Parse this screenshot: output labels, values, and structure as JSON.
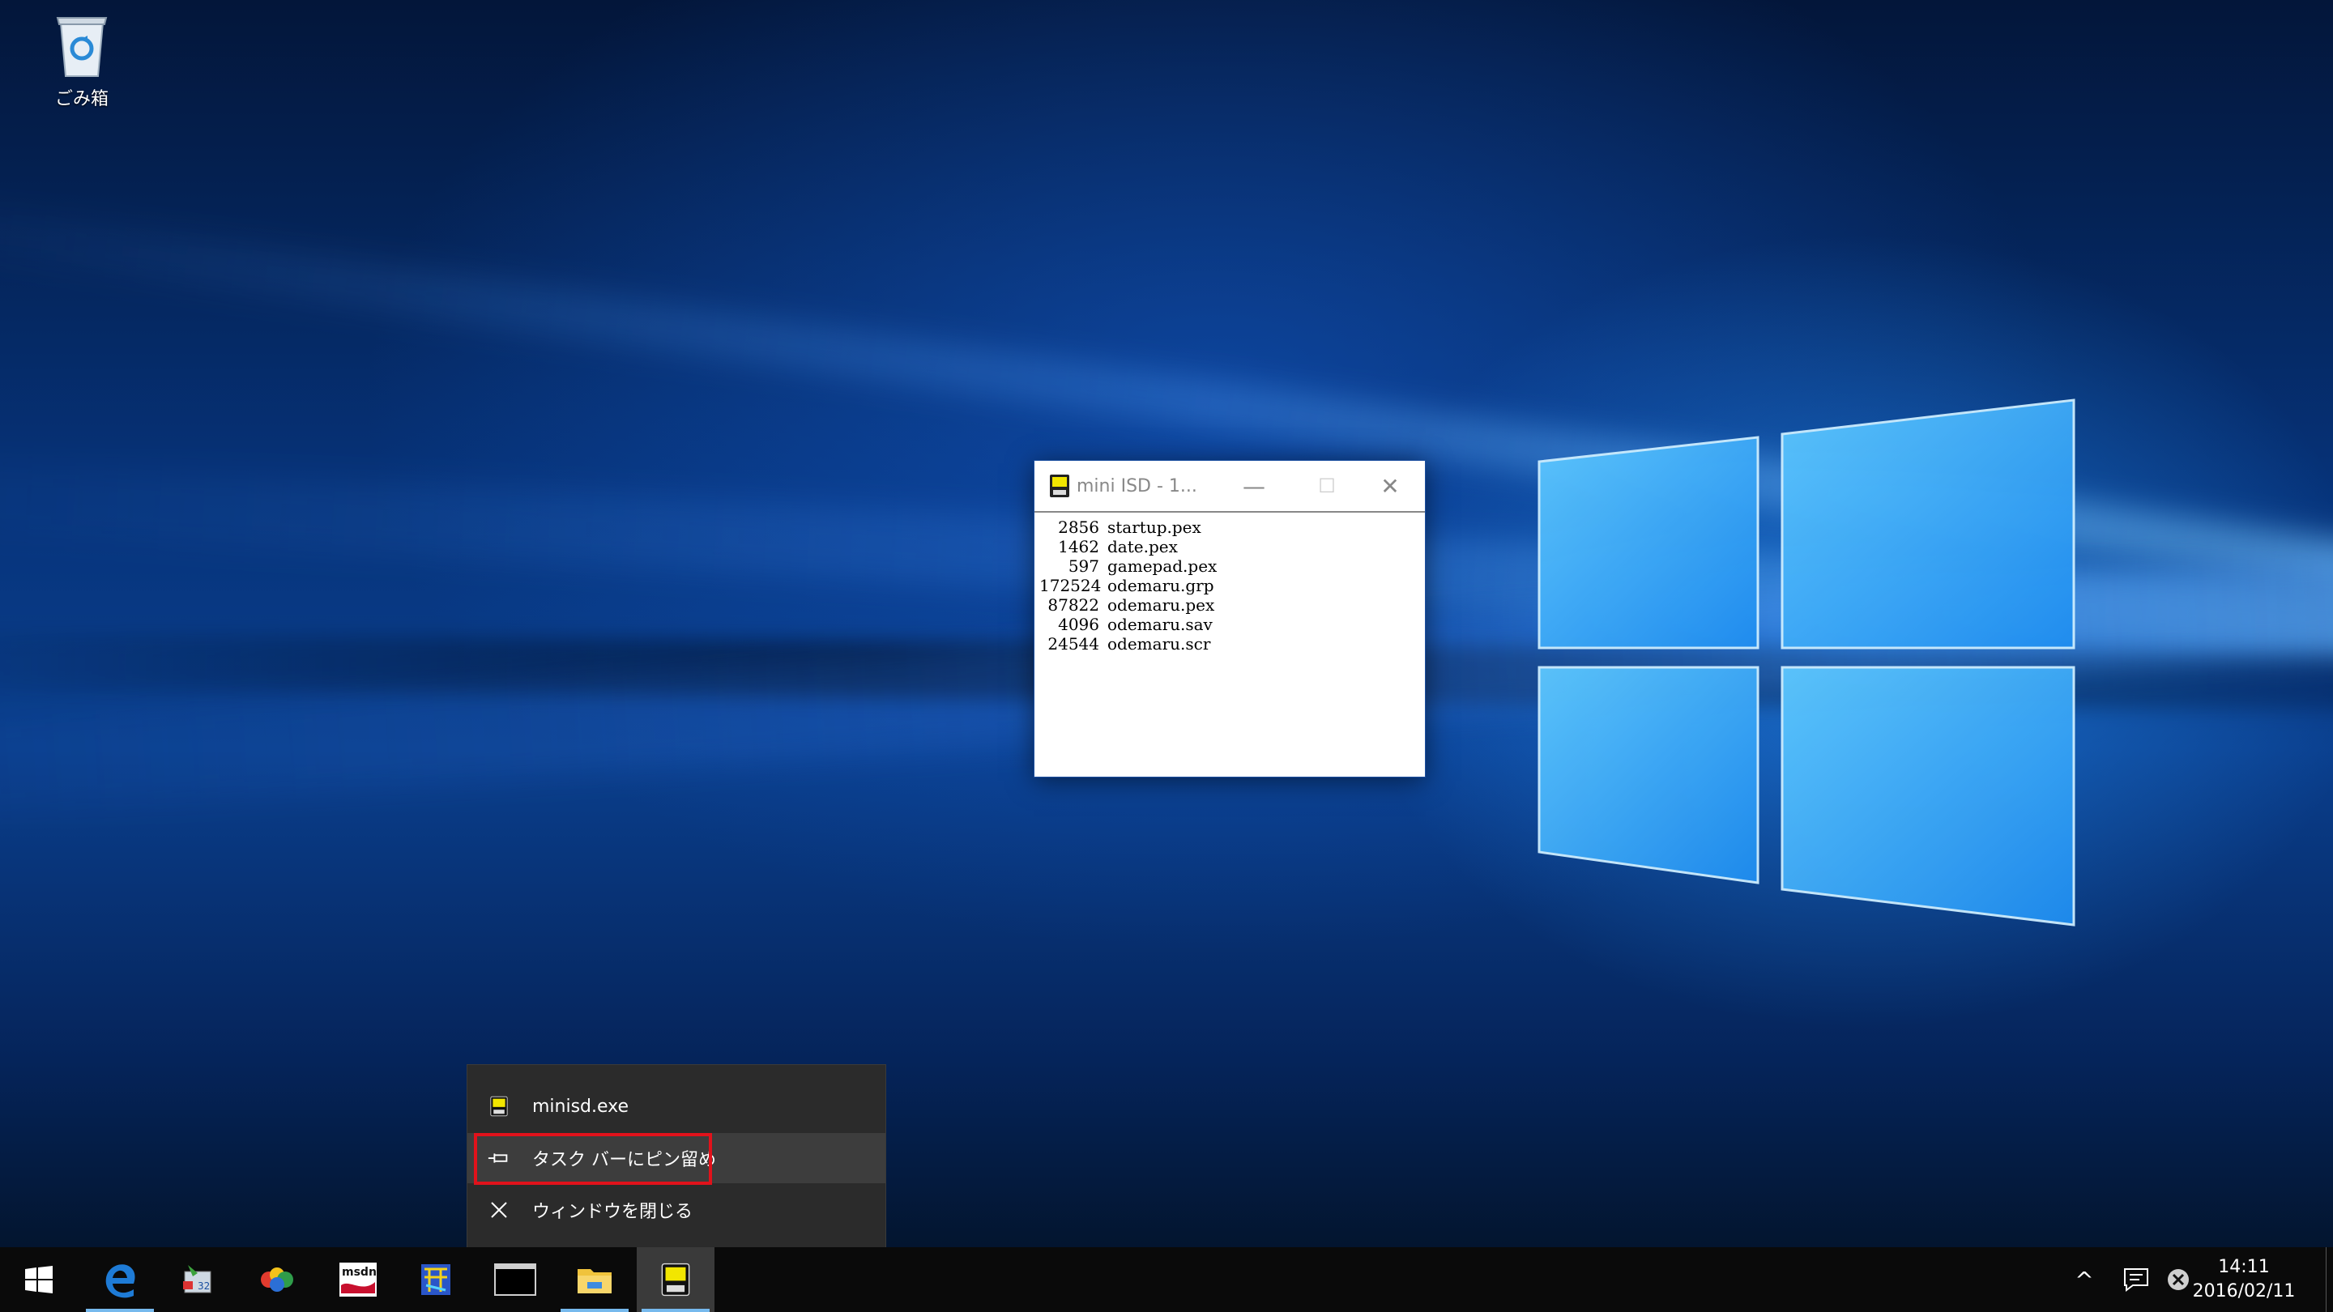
{
  "desktop": {
    "icons": [
      {
        "label": "ごみ箱",
        "icon": "recycle-bin-icon"
      }
    ]
  },
  "app_window": {
    "title": "mini ISD - 1...",
    "icon": "minisd-app-icon",
    "controls": {
      "minimize": "—",
      "maximize": "☐",
      "close": "✕"
    },
    "files": [
      {
        "size": "2856",
        "name": "startup.pex"
      },
      {
        "size": "1462",
        "name": "date.pex"
      },
      {
        "size": "597",
        "name": "gamepad.pex"
      },
      {
        "size": "172524",
        "name": "odemaru.grp"
      },
      {
        "size": "87822",
        "name": "odemaru.pex"
      },
      {
        "size": "4096",
        "name": "odemaru.sav"
      },
      {
        "size": "24544",
        "name": "odemaru.scr"
      }
    ]
  },
  "jumplist": {
    "items": [
      {
        "label": "minisd.exe",
        "icon": "minisd-app-icon"
      },
      {
        "label": "タスク バーにピン留め",
        "icon": "pin-icon"
      },
      {
        "label": "ウィンドウを閉じる",
        "icon": "close-icon"
      }
    ]
  },
  "taskbar": {
    "buttons": [
      {
        "icon": "start-windows-icon"
      },
      {
        "icon": "edge-browser-icon"
      },
      {
        "icon": "app-32-icon"
      },
      {
        "icon": "colorful-app-icon"
      },
      {
        "icon": "msdn-icon"
      },
      {
        "icon": "blue-app-icon"
      },
      {
        "icon": "console-icon"
      },
      {
        "icon": "file-explorer-icon"
      },
      {
        "icon": "minisd-app-icon"
      }
    ],
    "tray": {
      "chevron": "^",
      "notifications_icon": "action-center-icon",
      "status_icon": "x-circle-icon"
    },
    "clock": {
      "time": "14:11",
      "date": "2016/02/11"
    }
  },
  "colors": {
    "taskbar_bg": "#0a0a0a",
    "jumplist_bg": "#2b2b2b",
    "highlight_red": "#e1121b",
    "accent_underline": "#76b9ed"
  }
}
